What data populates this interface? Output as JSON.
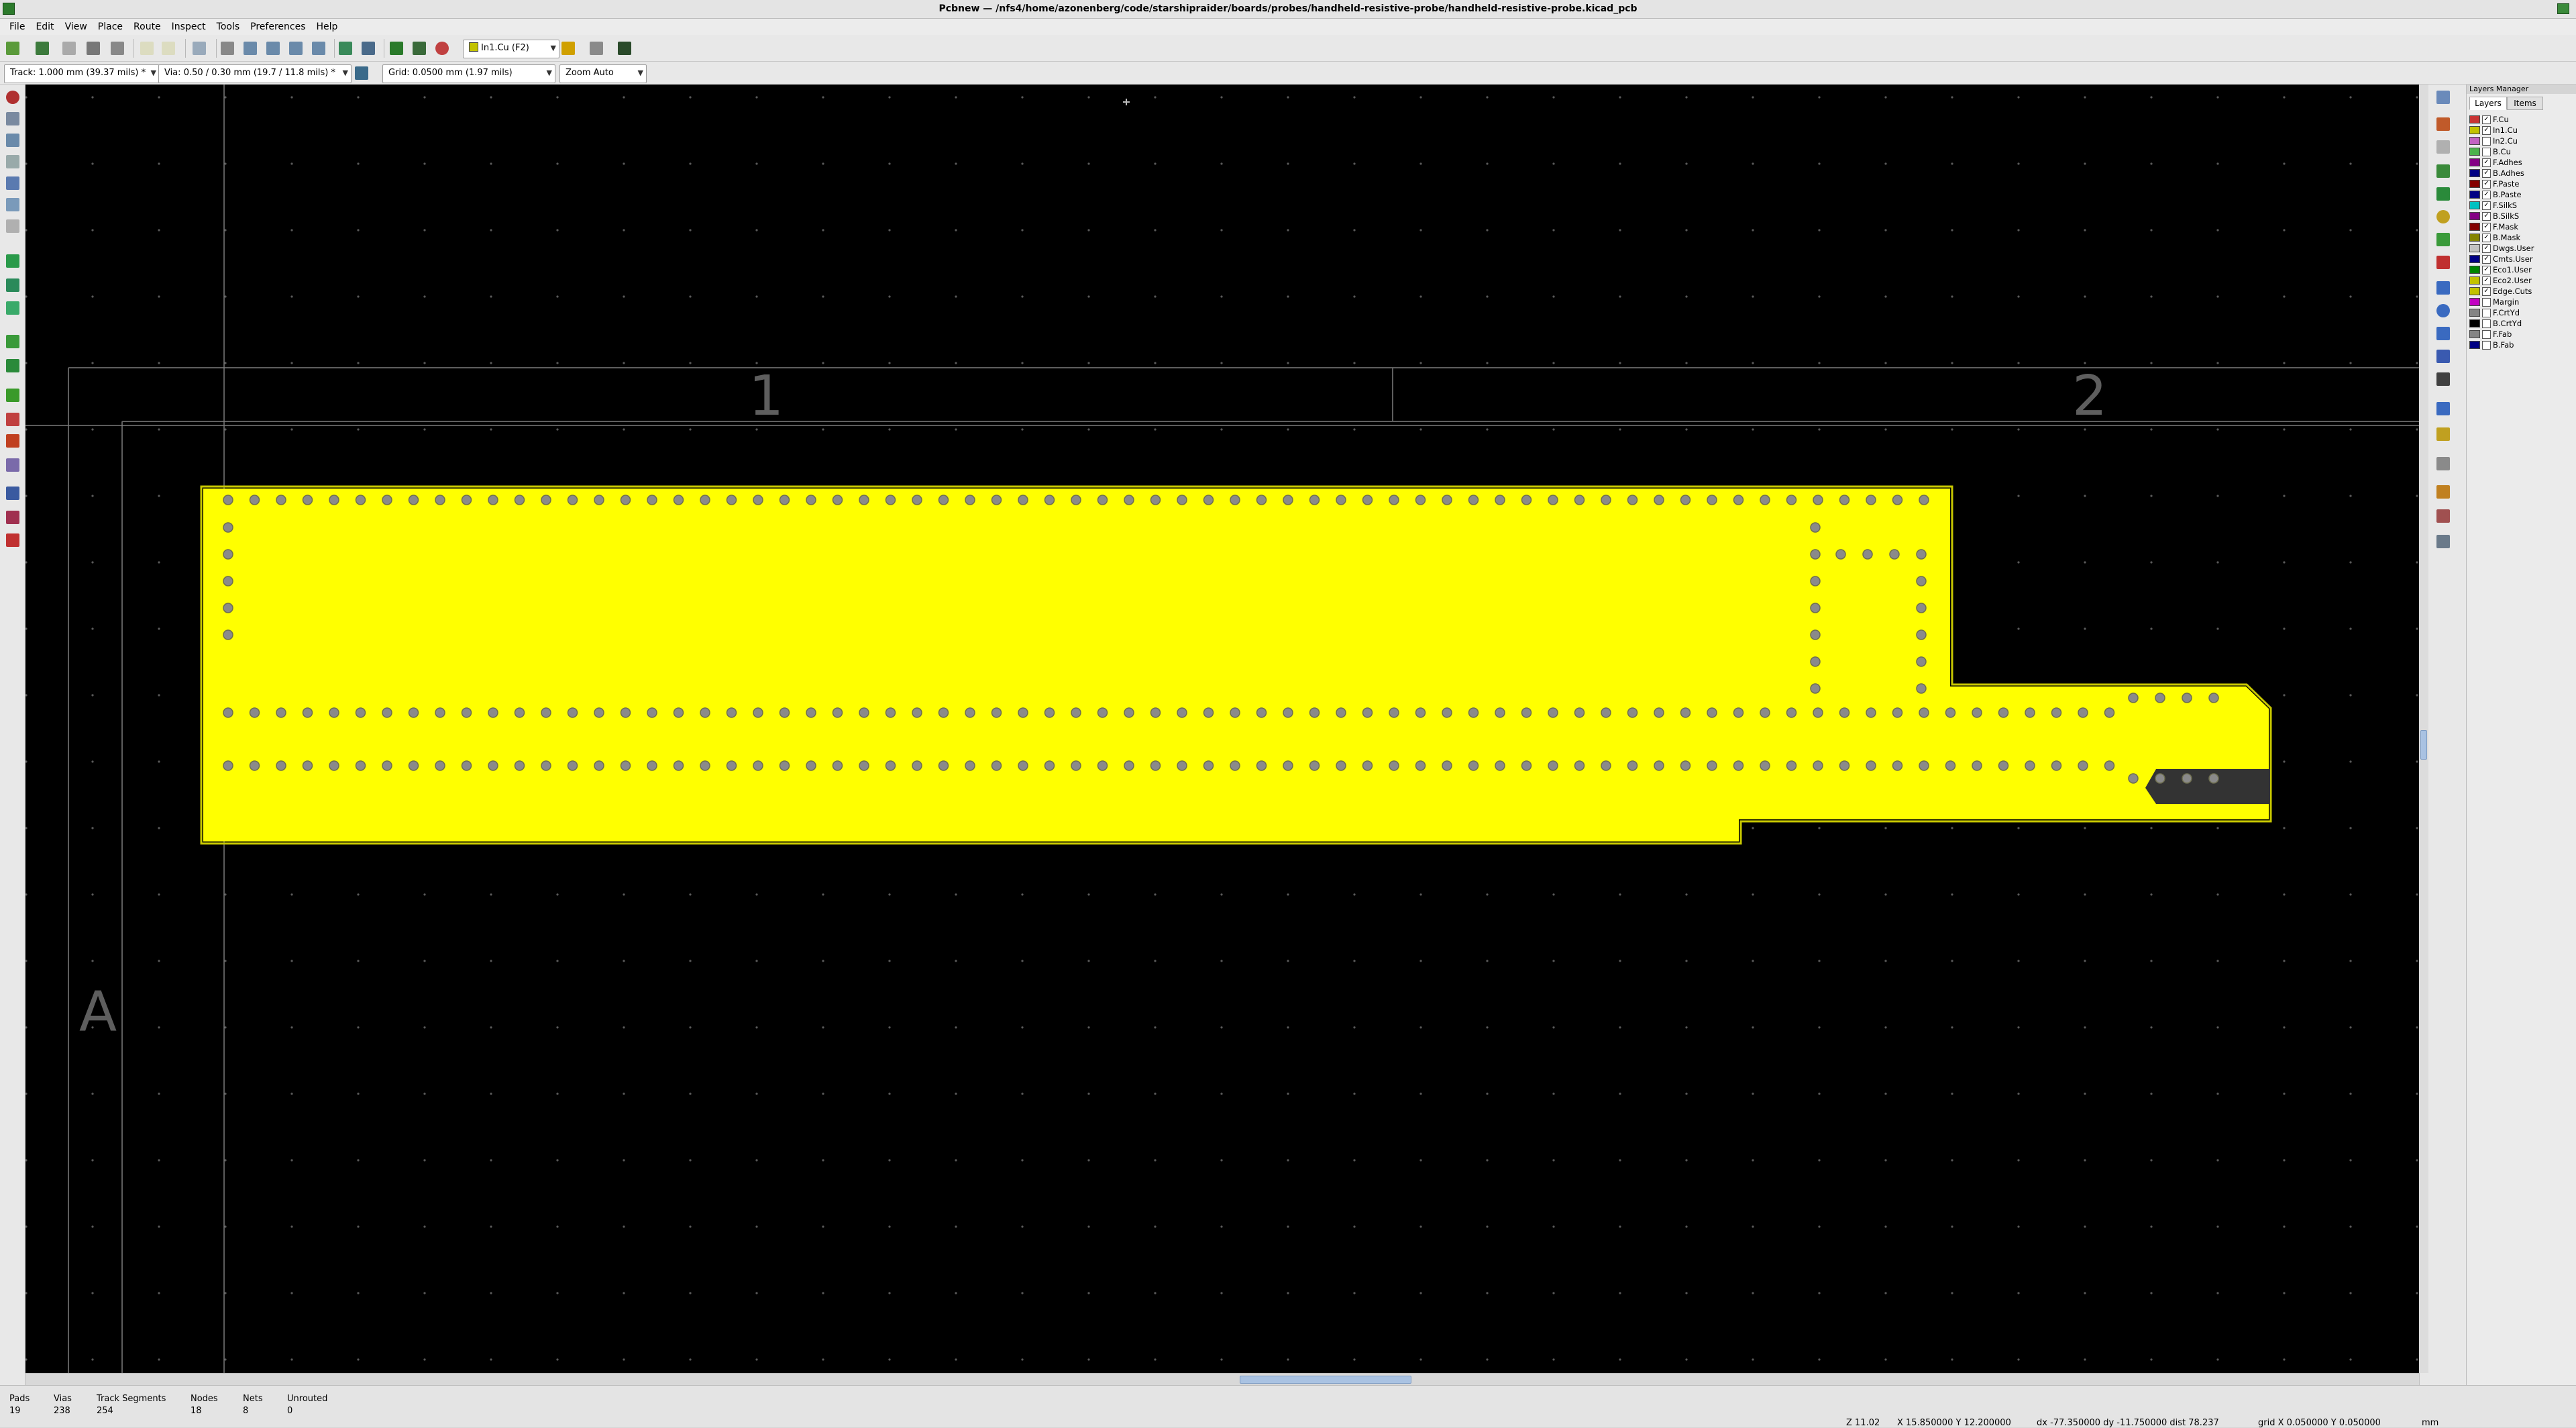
{
  "window": {
    "title": "Pcbnew — /nfs4/home/azonenberg/code/starshipraider/boards/probes/handheld-resistive-probe/handheld-resistive-probe.kicad_pcb"
  },
  "menu": [
    "File",
    "Edit",
    "View",
    "Place",
    "Route",
    "Inspect",
    "Tools",
    "Preferences",
    "Help"
  ],
  "toolbar": {
    "layer_select": "In1.Cu (F2)",
    "track_width": "Track: 1.000 mm (39.37 mils) *",
    "via_size": "Via: 0.50 / 0.30 mm (19.7 / 11.8 mils) *",
    "grid": "Grid: 0.0500 mm (1.97 mils)",
    "zoom": "Zoom Auto"
  },
  "sheet": {
    "col_labels": [
      "1",
      "2"
    ],
    "row_labels": [
      "A"
    ]
  },
  "colors": {
    "copper_fill": "#ffff00",
    "board_edge": "#c8c800",
    "background": "#000000",
    "via": "#8a8a8a",
    "grid_dot": "#5a5a5a",
    "frame_line": "#5e5e5e",
    "slot": "#333333"
  },
  "layers_manager": {
    "title": "Layers Manager",
    "tabs": [
      "Layers",
      "Items"
    ],
    "layers": [
      {
        "name": "F.Cu",
        "color": "#c83434",
        "checked": true
      },
      {
        "name": "In1.Cu",
        "color": "#c2c200",
        "checked": true
      },
      {
        "name": "In2.Cu",
        "color": "#c262c2",
        "checked": false
      },
      {
        "name": "B.Cu",
        "color": "#4cb24c",
        "checked": false
      },
      {
        "name": "F.Adhes",
        "color": "#840084",
        "checked": true
      },
      {
        "name": "B.Adhes",
        "color": "#000084",
        "checked": true
      },
      {
        "name": "F.Paste",
        "color": "#840000",
        "checked": true
      },
      {
        "name": "B.Paste",
        "color": "#000084",
        "checked": true
      },
      {
        "name": "F.SilkS",
        "color": "#00c2c2",
        "checked": true
      },
      {
        "name": "B.SilkS",
        "color": "#840084",
        "checked": true
      },
      {
        "name": "F.Mask",
        "color": "#840000",
        "checked": true
      },
      {
        "name": "B.Mask",
        "color": "#848400",
        "checked": true
      },
      {
        "name": "Dwgs.User",
        "color": "#c2c2c2",
        "checked": true
      },
      {
        "name": "Cmts.User",
        "color": "#000084",
        "checked": true
      },
      {
        "name": "Eco1.User",
        "color": "#008400",
        "checked": true
      },
      {
        "name": "Eco2.User",
        "color": "#c2c200",
        "checked": true
      },
      {
        "name": "Edge.Cuts",
        "color": "#c2c200",
        "checked": true
      },
      {
        "name": "Margin",
        "color": "#c200c2",
        "checked": false
      },
      {
        "name": "F.CrtYd",
        "color": "#848484",
        "checked": false
      },
      {
        "name": "B.CrtYd",
        "color": "#000000",
        "checked": false
      },
      {
        "name": "F.Fab",
        "color": "#848484",
        "checked": false
      },
      {
        "name": "B.Fab",
        "color": "#000084",
        "checked": false
      }
    ]
  },
  "status": {
    "stats": [
      {
        "label": "Pads",
        "value": "19"
      },
      {
        "label": "Vias",
        "value": "238"
      },
      {
        "label": "Track Segments",
        "value": "254"
      },
      {
        "label": "Nodes",
        "value": "18"
      },
      {
        "label": "Nets",
        "value": "8"
      },
      {
        "label": "Unrouted",
        "value": "0"
      }
    ],
    "zoom": "Z 11.02",
    "cursor": "X 15.850000  Y 12.200000",
    "delta": "dx -77.350000  dy -11.750000  dist 78.237",
    "grid": "grid X 0.050000  Y 0.050000",
    "units": "mm"
  }
}
